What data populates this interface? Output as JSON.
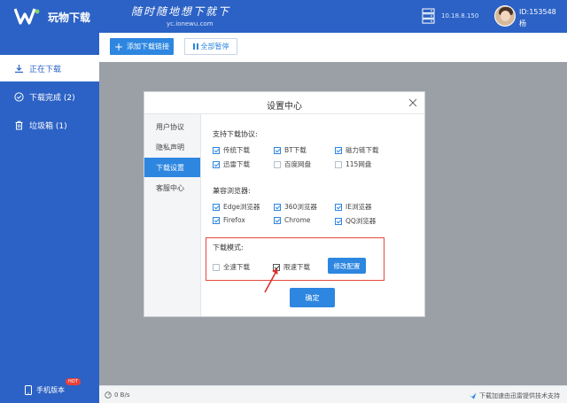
{
  "header": {
    "app_title": "玩物下载",
    "slogan": "随时随地想下就下",
    "slogan_url": "yc.ionewu.com",
    "ip": "10.18.8.150",
    "user_id": "ID:153548",
    "user_name": "杨"
  },
  "sidebar": {
    "items": [
      {
        "label": "正在下载",
        "icon": "download-icon"
      },
      {
        "label": "下载完成 (2)",
        "icon": "check-circle-icon"
      },
      {
        "label": "垃圾箱 (1)",
        "icon": "trash-icon"
      }
    ],
    "mobile_version": "手机版本",
    "hot_badge": "HOT"
  },
  "toolbar": {
    "add_link": "添加下载链接",
    "pause_all": "全部暂停"
  },
  "status_bar": {
    "speed": "0 B/s",
    "provider": "下载加速由迅雷提供技术支持"
  },
  "dialog": {
    "title": "设置中心",
    "nav": [
      "用户协议",
      "隐私声明",
      "下载设置",
      "客服中心"
    ],
    "protocols": {
      "title": "支持下载协议:",
      "items": [
        {
          "label": "传统下载",
          "checked": true
        },
        {
          "label": "BT下载",
          "checked": true
        },
        {
          "label": "磁力链下载",
          "checked": true
        },
        {
          "label": "迅雷下载",
          "checked": true
        },
        {
          "label": "百度网盘",
          "checked": false
        },
        {
          "label": "115网盘",
          "checked": false
        }
      ]
    },
    "browsers": {
      "title": "兼容浏览器:",
      "items": [
        {
          "label": "Edge浏览器",
          "checked": true
        },
        {
          "label": "360浏览器",
          "checked": true
        },
        {
          "label": "IE浏览器",
          "checked": true
        },
        {
          "label": "Firefox",
          "checked": true
        },
        {
          "label": "Chrome",
          "checked": true
        },
        {
          "label": "QQ浏览器",
          "checked": true
        }
      ]
    },
    "mode": {
      "title": "下载模式:",
      "full_speed": "全速下载",
      "limit_speed": "限速下载",
      "modify": "修改配置"
    },
    "ok": "确定"
  },
  "colors": {
    "brand": "#2c62c5",
    "accent": "#2d86e0",
    "highlight": "#e5473f"
  }
}
